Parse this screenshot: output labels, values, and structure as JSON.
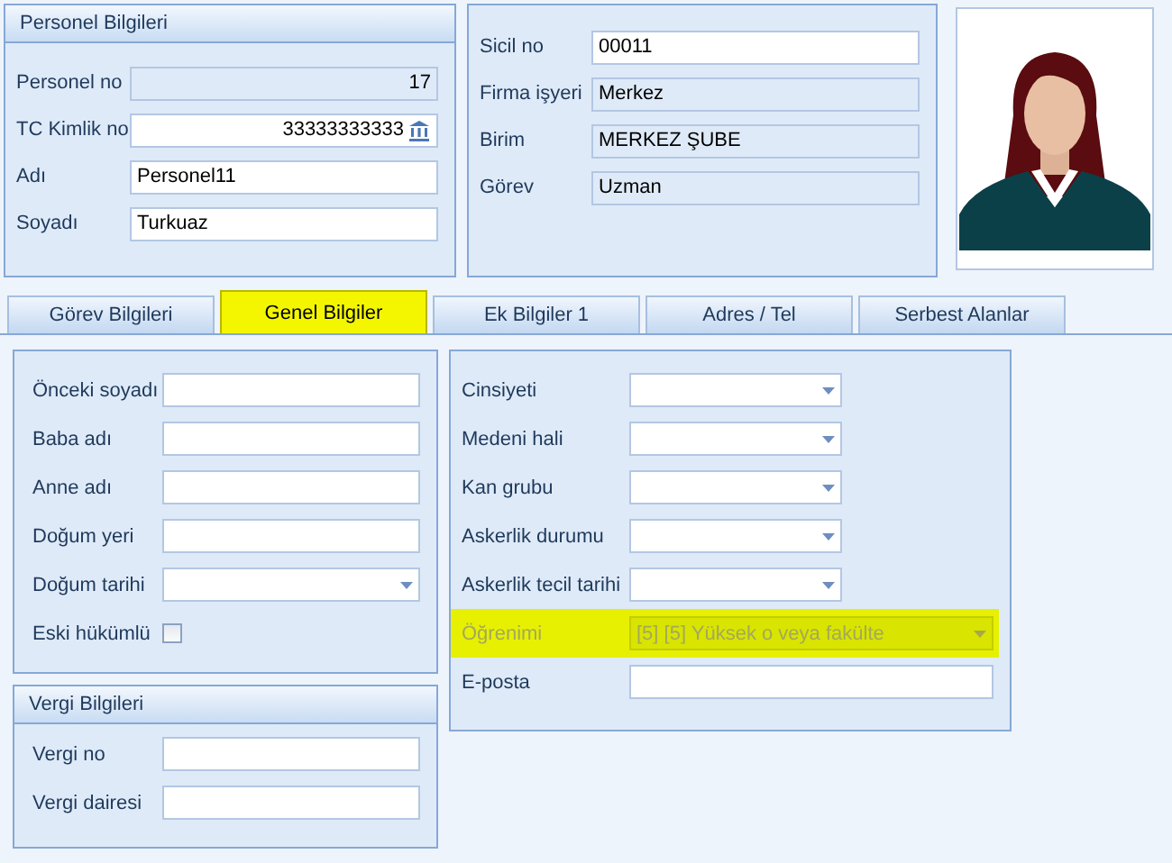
{
  "personnel": {
    "title": "Personel Bilgileri",
    "fields": [
      {
        "label": "Personel no",
        "value": "17",
        "kind": "number"
      },
      {
        "label": "TC Kimlik no",
        "value": "33333333333",
        "kind": "id-number"
      },
      {
        "label": "Adı",
        "value": "Personel11",
        "kind": "text"
      },
      {
        "label": "Soyadı",
        "value": "Turkuaz",
        "kind": "text"
      }
    ]
  },
  "employment": {
    "fields": [
      {
        "label": "Sicil no",
        "value": "00011",
        "kind": "text"
      },
      {
        "label": "Firma işyeri",
        "value": "Merkez",
        "kind": "readonly"
      },
      {
        "label": "Birim",
        "value": "MERKEZ ŞUBE",
        "kind": "readonly"
      },
      {
        "label": "Görev",
        "value": "Uzman",
        "kind": "readonly"
      }
    ]
  },
  "tabs": [
    {
      "label": "Görev Bilgileri",
      "selected": false
    },
    {
      "label": "Genel Bilgiler",
      "selected": true
    },
    {
      "label": "Ek Bilgiler 1",
      "selected": false
    },
    {
      "label": "Adres / Tel",
      "selected": false
    },
    {
      "label": "Serbest Alanlar",
      "selected": false
    }
  ],
  "general": {
    "fields": [
      {
        "label": "Önceki soyadı",
        "kind": "text"
      },
      {
        "label": "Baba adı",
        "kind": "text"
      },
      {
        "label": "Anne adı",
        "kind": "text"
      },
      {
        "label": "Doğum yeri",
        "kind": "text"
      },
      {
        "label": "Doğum tarihi",
        "kind": "combo"
      },
      {
        "label": "Eski hükümlü",
        "kind": "checkbox",
        "checked": false
      }
    ]
  },
  "tax": {
    "title": "Vergi Bilgileri",
    "fields": [
      {
        "label": "Vergi no",
        "kind": "text"
      },
      {
        "label": "Vergi dairesi",
        "kind": "text"
      }
    ]
  },
  "details": {
    "fields": [
      {
        "label": "Cinsiyeti",
        "kind": "combo",
        "disabled": false,
        "highlighted": false
      },
      {
        "label": "Medeni hali",
        "kind": "combo",
        "disabled": false,
        "highlighted": false
      },
      {
        "label": "Kan grubu",
        "kind": "combo",
        "disabled": false,
        "highlighted": false
      },
      {
        "label": "Askerlik durumu",
        "kind": "combo",
        "disabled": false,
        "highlighted": false
      },
      {
        "label": "Askerlik tecil tarihi",
        "kind": "combo",
        "disabled": false,
        "highlighted": false
      },
      {
        "label": "Öğrenimi",
        "value": "[5] [5] Yüksek o veya fakülte",
        "kind": "combo",
        "disabled": true,
        "highlighted": true
      },
      {
        "label": "E-posta",
        "kind": "wide-text",
        "disabled": false,
        "highlighted": false
      }
    ]
  }
}
